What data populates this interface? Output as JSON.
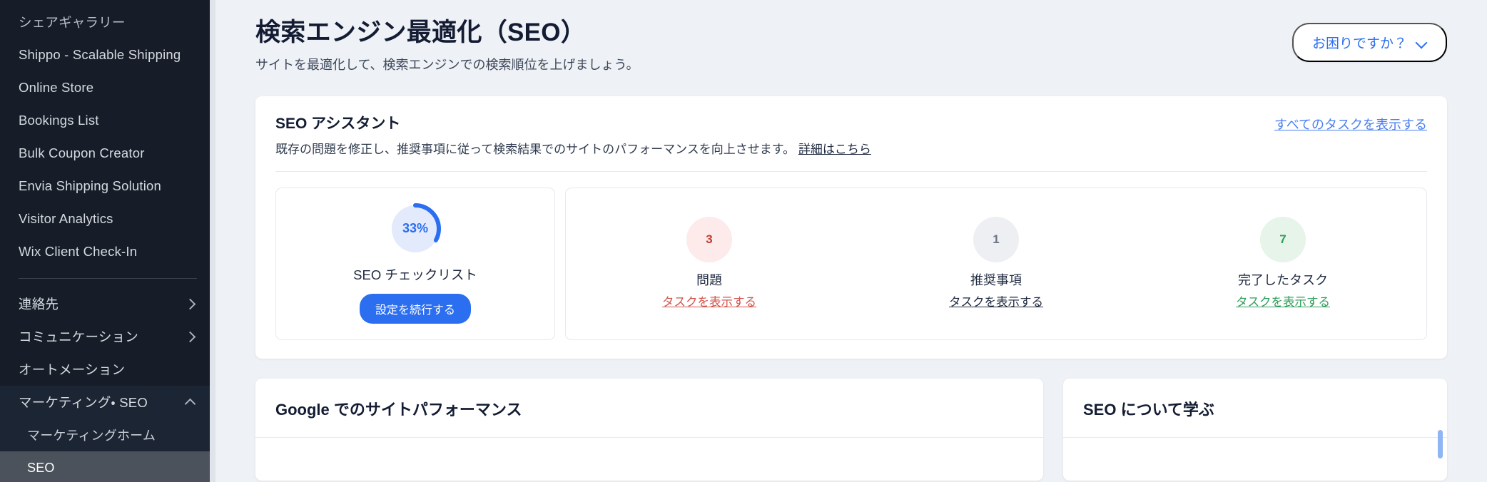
{
  "sidebar": {
    "items": [
      {
        "label": "シェアギャラリー",
        "type": "link",
        "state": "muted"
      },
      {
        "label": "Shippo - Scalable Shipping",
        "type": "link"
      },
      {
        "label": "Online Store",
        "type": "link"
      },
      {
        "label": "Bookings List",
        "type": "link"
      },
      {
        "label": "Bulk Coupon Creator",
        "type": "link"
      },
      {
        "label": "Envia Shipping Solution",
        "type": "link"
      },
      {
        "label": "Visitor Analytics",
        "type": "link"
      },
      {
        "label": "Wix Client Check-In",
        "type": "link"
      }
    ],
    "items2": [
      {
        "label": "連絡先",
        "type": "expandable",
        "icon": "chevron-right-icon"
      },
      {
        "label": "コミュニケーション",
        "type": "expandable",
        "icon": "chevron-right-icon"
      },
      {
        "label": "オートメーション",
        "type": "link"
      },
      {
        "label": "マーケティング・ SEO",
        "type": "expandable-open",
        "icon": "chevron-up-icon"
      }
    ],
    "subitems": [
      {
        "label": "マーケティングホーム",
        "selected": false
      },
      {
        "label": "SEO",
        "selected": true
      }
    ]
  },
  "header": {
    "title": "検索エンジン最適化（SEO）",
    "subtitle": "サイトを最適化して、検索エンジンでの検索順位を上げましょう。",
    "help_label": "お困りですか？",
    "help_icon": "chevron-down-icon"
  },
  "assistant": {
    "title": "SEO アシスタント",
    "description": "既存の問題を修正し、推奨事項に従って検索結果でのサイトのパフォーマンスを向上させます。",
    "description_link": "詳細はこちら",
    "view_all_tasks": "すべてのタスクを表示する",
    "checklist": {
      "percent_label": "33%",
      "percent_value": 33,
      "label": "SEO チェックリスト",
      "button_label": "設定を続行する",
      "ring_color": "#2b6ef0",
      "ring_track_color": "#e3eafc"
    },
    "stats": [
      {
        "value": "3",
        "label": "問題",
        "link": "タスクを表示する",
        "bubble_bg": "#fdeaea",
        "value_color": "#c43a32",
        "link_color": "#d3534a"
      },
      {
        "value": "1",
        "label": "推奨事項",
        "link": "タスクを表示する",
        "bubble_bg": "#edeff3",
        "value_color": "#6b7485",
        "link_color": "#1f2a40"
      },
      {
        "value": "7",
        "label": "完了したタスク",
        "link": "タスクを表示する",
        "bubble_bg": "#e6f4ea",
        "value_color": "#2e9e5b",
        "link_color": "#2e9e5b"
      }
    ]
  },
  "bottom": {
    "performance_title": "Google でのサイトパフォーマンス",
    "learn_title": "SEO について学ぶ"
  }
}
